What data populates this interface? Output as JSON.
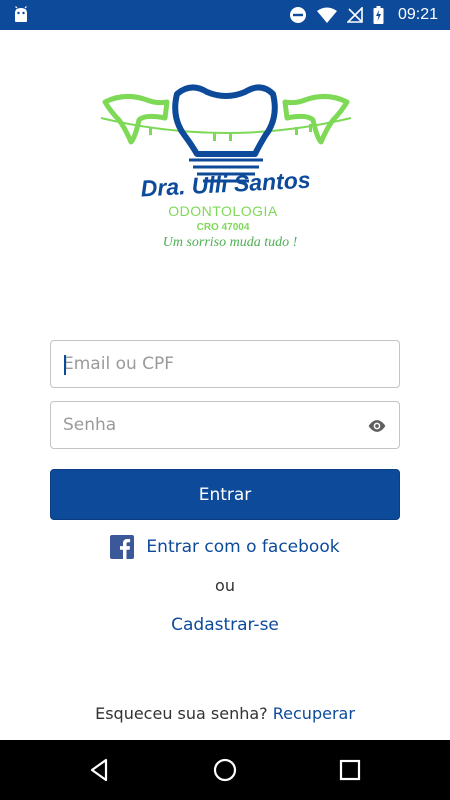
{
  "status_bar": {
    "time": "09:21",
    "icons": [
      "android-icon",
      "do-not-disturb-icon",
      "wifi-icon",
      "no-signal-icon",
      "battery-charging-icon"
    ]
  },
  "logo": {
    "name": "Dra. Ulli Santos",
    "subtitle": "ODONTOLOGIA",
    "registration": "CRO 47004",
    "tagline": "Um sorriso muda tudo !"
  },
  "form": {
    "email": {
      "placeholder": "Email ou CPF",
      "value": ""
    },
    "password": {
      "placeholder": "Senha",
      "value": "",
      "toggle_icon": "eye-icon"
    }
  },
  "actions": {
    "login_label": "Entrar",
    "facebook_label": "Entrar com o facebook",
    "facebook_icon": "facebook-icon",
    "or_label": "ou",
    "signup_label": "Cadastrar-se",
    "forgot_text": "Esqueceu sua senha?",
    "recover_label": "Recuperar"
  },
  "nav_bar": {
    "buttons": [
      "back-icon",
      "home-icon",
      "recents-icon"
    ]
  },
  "colors": {
    "primary": "#0d4a9a",
    "logo_green": "#7ed957",
    "logo_green_dark": "#4caf50",
    "status_bar": "#0d4a9a",
    "nav_bar": "#000000"
  }
}
